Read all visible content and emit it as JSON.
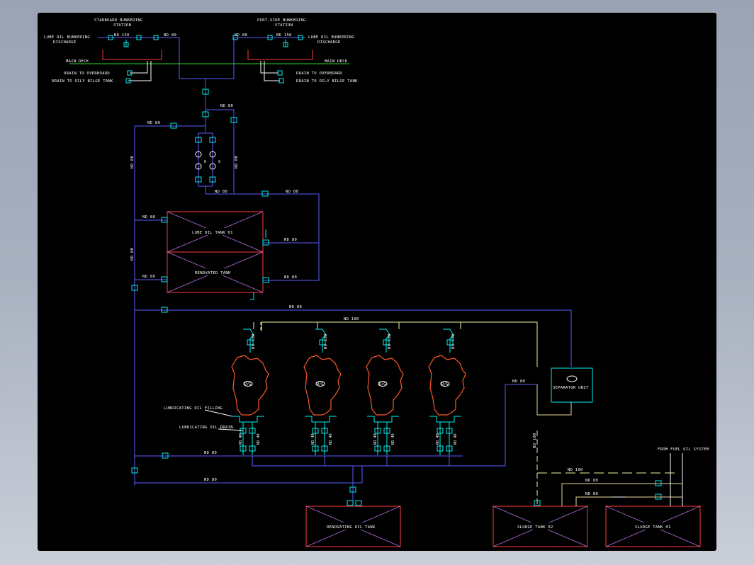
{
  "labels": {
    "starboard_station": "STARBOARD BUNKERING",
    "starboard_station2": "STATION",
    "portside_station": "PORT-SIDE BUNKERING",
    "portside_station2": "STATION",
    "lube_bunkering_left": "LUBE OIL BUNKERING",
    "discharge_left": "DISCHARGE",
    "lube_bunkering_right": "LUBE OIL BUNKERING",
    "discharge_right": "DISCHARGE",
    "main_deck_left": "MAIN DECK",
    "main_deck_right": "MAIN DECK",
    "drain_overboard_left": "DRAIN TO OVERBOARD",
    "drain_bilge_left": "DRAIN TO OILY BILGE TANK",
    "drain_overboard_right": "DRAIN TO OVERBOARD",
    "drain_bilge_right": "DRAIN TO OILY BILGE TANK",
    "lube_tank": "LUBE OIL TANK 01",
    "renovated_tank": "RENOVATED TANK",
    "separator": "SEPARATOR UNIT",
    "lub_filling": "LUBRICATING OIL FILLING",
    "lub_drain": "LUBRICATING OIL DRAIN",
    "renovating_tank": "RENOVATING OIL TANK",
    "sludge_02": "SLUDGE TANK 02",
    "sludge_01": "SLUDGE TANK 01",
    "from_fuel": "FROM FUEL OIL SYSTEM",
    "engine_tag": "D/G"
  },
  "pipe_sizes": {
    "nd150": "ND 150",
    "nd80": "ND 80",
    "nd100": "ND 100",
    "nd40": "ND 40"
  },
  "colors": {
    "background": "#000000",
    "pipe": "#5a5cff",
    "tank_outline": "#ff3b3b",
    "tank_cross": "#c070e0",
    "valve": "#00f0f0",
    "engine": "#ff5a2a",
    "deck_line": "#2ed12e",
    "vent": "#f2f2a0"
  }
}
